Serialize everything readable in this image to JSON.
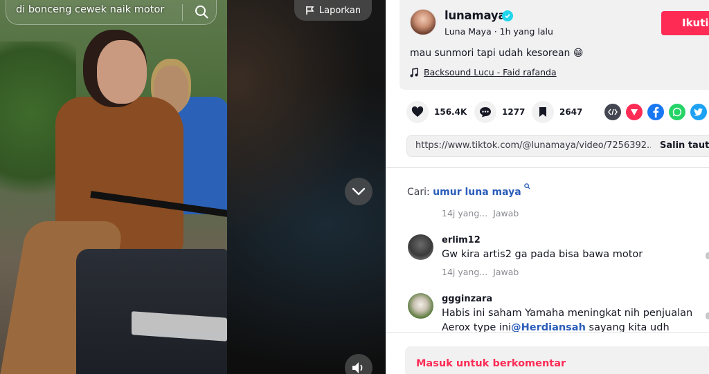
{
  "search": {
    "query": "di bonceng cewek naik motor"
  },
  "video": {
    "report_label": "Laporkan"
  },
  "author": {
    "username": "lunamaya",
    "nickname": "Luna Maya",
    "separator": " · ",
    "time_ago": "1h yang lalu",
    "follow_label": "Ikuti"
  },
  "post": {
    "caption": "mau sunmori tapi udah kesorean 😁",
    "music": "Backsound Lucu - Faid rafanda"
  },
  "actions": {
    "likes": "156.4K",
    "comments": "1277",
    "saves": "2647"
  },
  "share": {
    "link": "https://www.tiktok.com/@lunamaya/video/7256392...",
    "copy_label": "Salin tautan"
  },
  "suggested_search": {
    "label": "Cari:",
    "query": "umur luna maya"
  },
  "comments": [
    {
      "username": "",
      "text": "",
      "meta": "14j yang...",
      "reply": "Jawab"
    },
    {
      "username": "erlim12",
      "text": "Gw kira artis2 ga pada bisa bawa motor",
      "meta": "14j yang...",
      "reply": "Jawab"
    },
    {
      "username": "ggginzara",
      "text_line1": "Habis ini saham Yamaha meningkat nih penjualan",
      "text_line2_before": "Aerox type ini",
      "mention": "@Herdiansah",
      "text_line2_after": "  sayang kita udh"
    }
  ],
  "login": {
    "label": "Masuk untuk berkomentar"
  },
  "colors": {
    "accent": "#fe2c55",
    "link": "#2b5db9",
    "verified": "#20d5ec"
  },
  "icons": [
    "search-icon",
    "flag-icon",
    "chevron-down-icon",
    "volume-icon",
    "verified-icon",
    "music-note-icon",
    "heart-icon",
    "comment-icon",
    "bookmark-icon",
    "embed-icon",
    "send-icon",
    "facebook-icon",
    "whatsapp-icon",
    "twitter-icon"
  ]
}
